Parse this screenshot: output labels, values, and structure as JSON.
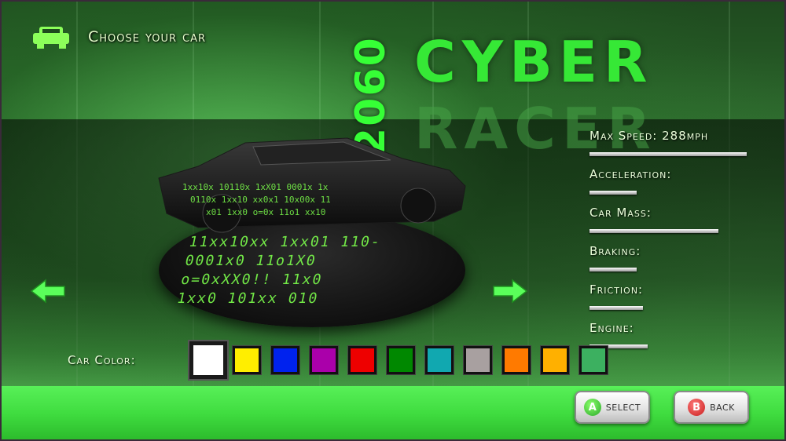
{
  "header": {
    "title": "Choose your car",
    "icon": "car-icon"
  },
  "logo": {
    "year": "2060",
    "line1": "CYBER",
    "line2": "RACER"
  },
  "platform_code": [
    "11xx10xx 1xx01 110-",
    "0001x0 11o1X0",
    "o=0xXX0!! 11x0",
    "1xx0 101xx 010"
  ],
  "nav": {
    "left_icon": "arrow-left-icon",
    "right_icon": "arrow-right-icon"
  },
  "stats": [
    {
      "label": "Max Speed: 288mph",
      "level": 1.0
    },
    {
      "label": "Acceleration:",
      "level": 0.3
    },
    {
      "label": "Car Mass:",
      "level": 0.82
    },
    {
      "label": "Braking:",
      "level": 0.3
    },
    {
      "label": "Friction:",
      "level": 0.34
    },
    {
      "label": "Engine:",
      "level": 0.37
    }
  ],
  "car_color": {
    "label": "Car Color:",
    "selected_index": 0,
    "swatches": [
      "#ffffff",
      "#ffee00",
      "#0022ee",
      "#aa00aa",
      "#ee0000",
      "#008800",
      "#11a8b0",
      "#a8a0a0",
      "#ff7a00",
      "#ffb000",
      "#3cb060"
    ]
  },
  "buttons": {
    "select": {
      "badge": "A",
      "label": "SELECT"
    },
    "back": {
      "badge": "B",
      "label": "BACK"
    }
  },
  "colors": {
    "accent": "#36ff36",
    "bottom_bar": "#44e044"
  }
}
